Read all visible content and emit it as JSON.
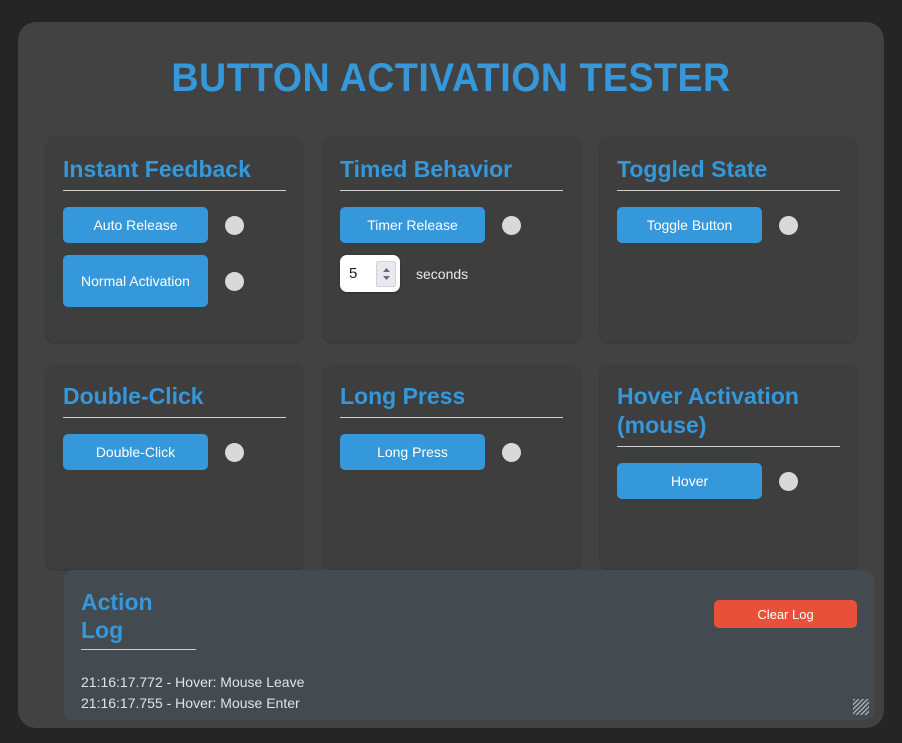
{
  "app": {
    "title": "BUTTON ACTIVATION TESTER",
    "accent_color": "#3498db",
    "danger_color": "#e8503a",
    "window_bg": "#424242",
    "card_bg": "#3e3e3e",
    "log_bg": "#434a50",
    "indicator_color": "#d9d9d9"
  },
  "cards": [
    {
      "title": "Instant Feedback",
      "buttons": [
        {
          "label": "Auto Release",
          "tall": false
        },
        {
          "label": "Normal Activation",
          "tall": true
        }
      ]
    },
    {
      "title": "Timed Behavior",
      "buttons": [
        {
          "label": "Timer Release",
          "tall": false
        }
      ],
      "spinner": {
        "value": "5",
        "unit_label": "seconds"
      }
    },
    {
      "title": "Toggled State",
      "buttons": [
        {
          "label": "Toggle Button",
          "tall": false
        }
      ]
    },
    {
      "title": "Double-Click",
      "buttons": [
        {
          "label": "Double-Click",
          "tall": false
        }
      ]
    },
    {
      "title": "Long Press",
      "buttons": [
        {
          "label": "Long Press",
          "tall": false
        }
      ]
    },
    {
      "title": "Hover Activation (mouse)",
      "buttons": [
        {
          "label": "Hover",
          "tall": false
        }
      ]
    }
  ],
  "log": {
    "title": "Action Log",
    "clear_label": "Clear Log",
    "entries": [
      "21:16:17.772 - Hover: Mouse Leave",
      "21:16:17.755 - Hover: Mouse Enter"
    ]
  }
}
